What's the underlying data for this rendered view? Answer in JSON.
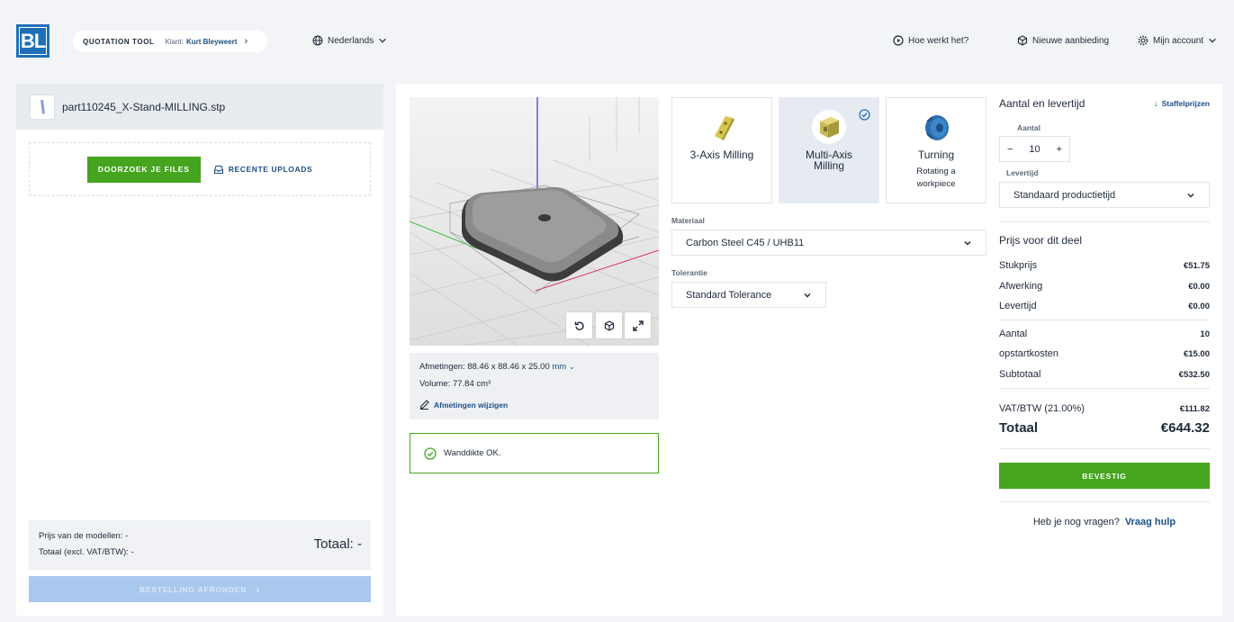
{
  "header": {
    "logo": "BL",
    "tool_label": "QUOTATION TOOL",
    "client_label": "Klant:",
    "client_name": "Kurt Bleyweert",
    "language": "Nederlands",
    "how_it_works": "Hoe werkt het?",
    "new_offer": "Nieuwe aanbieding",
    "account": "Mijn account"
  },
  "left": {
    "file_name": "part110245_X-Stand-MILLING.stp",
    "browse_label": "DOORZOEK JE FILES",
    "recent_label": "RECENTE UPLOADS",
    "models_price_label": "Prijs van de modellen:",
    "models_price_value": "-",
    "total_excl_label": "Totaal (excl. VAT/BTW):",
    "total_excl_value": "-",
    "total_label": "Totaal:",
    "total_value": "-",
    "order_label": "BESTELLING AFRONDEN"
  },
  "viewer": {
    "dims_label": "Afmetingen:",
    "dims_value": "88.46 x 88.46 x 25.00",
    "dims_unit": "mm",
    "volume_label": "Volume:",
    "volume_value": "77.84 cm³",
    "edit_dims": "Afmetingen wijzigen",
    "wall_status": "Wanddikte OK."
  },
  "process": {
    "options": [
      {
        "title": "3-Axis Milling",
        "subtitle": ""
      },
      {
        "title": "Multi-Axis Milling",
        "subtitle": ""
      },
      {
        "title": "Turning",
        "subtitle": "Rotating a workpiece"
      }
    ],
    "selected": "Multi-Axis Milling",
    "material_label": "Materiaal",
    "material_value": "Carbon Steel C45 / UHB11",
    "tolerance_label": "Tolerantie",
    "tolerance_value": "Standard Tolerance"
  },
  "quantity": {
    "title": "Aantal en levertijd",
    "tiered_link": "Staffelprijzen",
    "qty_label": "Aantal",
    "qty_value": "10",
    "minus": "−",
    "plus": "+",
    "lead_label": "Levertijd",
    "lead_value": "Standaard productietijd"
  },
  "price": {
    "title": "Prijs voor dit deel",
    "unit_label": "Stukprijs",
    "unit_value": "€51.75",
    "finish_label": "Afwerking",
    "finish_value": "€0.00",
    "lead_label": "Levertijd",
    "lead_value": "€0.00",
    "qty_label": "Aantal",
    "qty_value": "10",
    "setup_label": "opstartkosten",
    "setup_value": "€15.00",
    "subtotal_label": "Subtotaal",
    "subtotal_value": "€532.50",
    "vat_label": "VAT/BTW (21.00%)",
    "vat_value": "€111.82",
    "total_label": "Totaal",
    "total_value": "€644.32",
    "confirm_label": "BEVESTIG",
    "help_text": "Heb je nog vragen?",
    "help_link": "Vraag hulp"
  },
  "colors": {
    "accent_green": "#45a51f",
    "brand_blue": "#1f6fb7",
    "link_blue": "#1d4f86"
  }
}
